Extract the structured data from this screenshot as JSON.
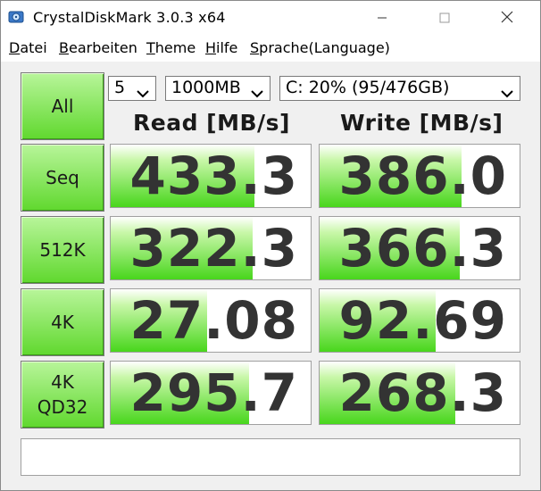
{
  "window": {
    "title": "CrystalDiskMark 3.0.3 x64"
  },
  "menu": [
    {
      "label": "Datei",
      "accel": "D",
      "rest": "atei"
    },
    {
      "label": "Bearbeiten",
      "accel": "B",
      "rest": "earbeiten"
    },
    {
      "label": "Theme",
      "accel": "T",
      "rest": "heme"
    },
    {
      "label": "Hilfe",
      "accel": "H",
      "rest": "ilfe"
    },
    {
      "label": "Sprache(Language)",
      "accel": "S",
      "rest": "prache(Language)"
    }
  ],
  "controls": {
    "all_label": "All",
    "runs": "5",
    "size": "1000MB",
    "drive": "C: 20% (95/476GB)"
  },
  "headers": {
    "read": "Read [MB/s]",
    "write": "Write [MB/s]"
  },
  "tests": [
    {
      "label": "Seq",
      "label2": "",
      "read": "433.3",
      "write": "386.0",
      "read_fill": 0.72,
      "write_fill": 0.71
    },
    {
      "label": "512K",
      "label2": "",
      "read": "322.3",
      "write": "366.3",
      "read_fill": 0.71,
      "write_fill": 0.7
    },
    {
      "label": "4K",
      "label2": "",
      "read": "27.08",
      "write": "92.69",
      "read_fill": 0.48,
      "write_fill": 0.58
    },
    {
      "label": "4K",
      "label2": "QD32",
      "read": "295.7",
      "write": "268.3",
      "read_fill": 0.69,
      "write_fill": 0.68
    }
  ],
  "status_text": "",
  "colors": {
    "button_green": "#60d82e",
    "bar_green": "#48d61c",
    "value_text": "#333333"
  },
  "icons": {
    "app": "crystaldiskmark-icon",
    "minimize": "minimize-icon",
    "maximize": "maximize-icon",
    "close": "close-icon",
    "dropdown": "chevron-down-icon"
  }
}
